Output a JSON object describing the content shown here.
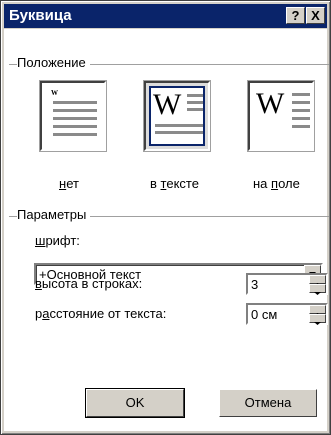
{
  "dialog": {
    "title": "Буквица",
    "help_button": "?",
    "close_button": "X"
  },
  "position": {
    "group_label": "Положение",
    "options": [
      {
        "label_u": "н",
        "label_rest": "ет",
        "selected": false
      },
      {
        "label_pre": "в ",
        "label_u": "т",
        "label_rest": "ексте",
        "selected": true
      },
      {
        "label_pre": "на ",
        "label_u": "п",
        "label_rest": "оле",
        "selected": false
      }
    ]
  },
  "params": {
    "group_label": "Параметры",
    "font_label_u": "ш",
    "font_label_rest": "рифт:",
    "font_value": "+Основной текст",
    "height_label_u": "в",
    "height_label_rest": "ысота в строках:",
    "height_value": "3",
    "distance_label_pre": "р",
    "distance_label_u": "а",
    "distance_label_rest": "сстояние от текста:",
    "distance_value": "0 см"
  },
  "buttons": {
    "ok": "OK",
    "cancel": "Отмена"
  }
}
